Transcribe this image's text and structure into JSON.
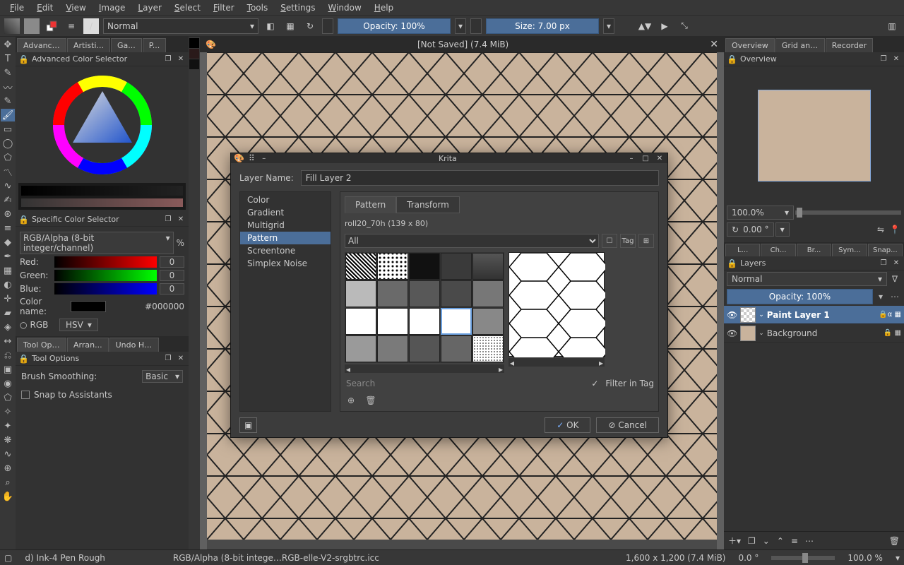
{
  "menu": [
    "File",
    "Edit",
    "View",
    "Image",
    "Layer",
    "Select",
    "Filter",
    "Tools",
    "Settings",
    "Window",
    "Help"
  ],
  "toolbar": {
    "blend_mode": "Normal",
    "opacity_label": "Opacity: 100%",
    "size_label": "Size: 7.00 px"
  },
  "document": {
    "title": "[Not Saved]  (7.4 MiB)"
  },
  "left_tabs": [
    "Advance...",
    "Artisti...",
    "Ga...",
    "P..."
  ],
  "color_selector_title": "Advanced Color Selector",
  "specific_title": "Specific Color Selector",
  "specific": {
    "profile": "RGB/Alpha (8-bit integer/channel)",
    "pct": "%",
    "red_label": "Red:",
    "red_val": "0",
    "green_label": "Green:",
    "green_val": "0",
    "blue_label": "Blue:",
    "blue_val": "0",
    "colorname_label": "Color name:",
    "hex": "#000000",
    "rgb": "RGB",
    "hsv": "HSV"
  },
  "tool_opt_tabs": [
    "Tool Optio...",
    "Arran...",
    "Undo Hist..."
  ],
  "tool_options_title": "Tool Options",
  "brush_smoothing_label": "Brush Smoothing:",
  "brush_smoothing_value": "Basic",
  "snap_label": "Snap to Assistants",
  "right_tabs": [
    "Overview",
    "Grid and Guides",
    "Recorder"
  ],
  "overview_title": "Overview",
  "zoom": "100.0%",
  "rotation": "0.00 °",
  "layer_filter_tabs": [
    "L...",
    "Ch...",
    "Br...",
    "Sym...",
    "Snap..."
  ],
  "layers_title": "Layers",
  "layer_blend": "Normal",
  "layer_opacity": "Opacity:  100%",
  "layers": [
    {
      "name": "Paint Layer 1",
      "selected": true,
      "bg": "#fff"
    },
    {
      "name": "Background",
      "selected": false,
      "bg": "#c9b39c"
    }
  ],
  "dialog": {
    "title": "Krita",
    "layer_name_label": "Layer Name:",
    "layer_name_value": "Fill Layer 2",
    "types": [
      "Color",
      "Gradient",
      "Multigrid",
      "Pattern",
      "Screentone",
      "Simplex Noise"
    ],
    "type_selected": "Pattern",
    "subtabs": [
      "Pattern",
      "Transform"
    ],
    "subtab_active": "Pattern",
    "pattern_name": "roll20_70h (139 x 80)",
    "tag_filter": "All",
    "tag_label": "Tag",
    "search_placeholder": "Search",
    "filter_in_tag": "Filter in Tag",
    "ok": "OK",
    "cancel": "Cancel"
  },
  "status": {
    "brush": "d) Ink-4 Pen Rough",
    "profile": "RGB/Alpha (8-bit intege…RGB-elle-V2-srgbtrc.icc",
    "dims": "1,600 x 1,200 (7.4 MiB)",
    "angle": "0.0 °",
    "zoom": "100.0 %"
  }
}
